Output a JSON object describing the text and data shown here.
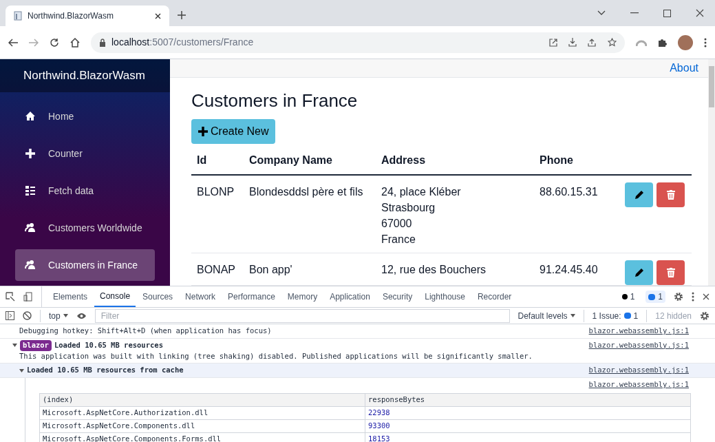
{
  "browser": {
    "tab_title": "Northwind.BlazorWasm",
    "url_host": "localhost",
    "url_path": ":5007/customers/France"
  },
  "app": {
    "brand": "Northwind.BlazorWasm",
    "about_link": "About",
    "nav": [
      {
        "label": "Home",
        "selected": false
      },
      {
        "label": "Counter",
        "selected": false
      },
      {
        "label": "Fetch data",
        "selected": false
      },
      {
        "label": "Customers Worldwide",
        "selected": false
      },
      {
        "label": "Customers in France",
        "selected": true
      }
    ],
    "heading": "Customers in France",
    "create_button": "Create New",
    "table": {
      "columns": [
        "Id",
        "Company Name",
        "Address",
        "Phone"
      ],
      "rows": [
        {
          "id": "BLONP",
          "company": "Blondesddsl père et fils",
          "address": [
            "24, place Kléber",
            "Strasbourg",
            "67000",
            "France"
          ],
          "phone": "88.60.15.31"
        },
        {
          "id": "BONAP",
          "company": "Bon app'",
          "address": [
            "12, rue des Bouchers"
          ],
          "phone": "91.24.45.40"
        }
      ]
    }
  },
  "devtools": {
    "tabs": [
      {
        "label": "Elements",
        "selected": false
      },
      {
        "label": "Console",
        "selected": true
      },
      {
        "label": "Sources",
        "selected": false
      },
      {
        "label": "Network",
        "selected": false
      },
      {
        "label": "Performance",
        "selected": false
      },
      {
        "label": "Memory",
        "selected": false
      },
      {
        "label": "Application",
        "selected": false
      },
      {
        "label": "Security",
        "selected": false
      },
      {
        "label": "Lighthouse",
        "selected": false
      },
      {
        "label": "Recorder",
        "selected": false
      }
    ],
    "error_count": "1",
    "message_count": "1",
    "context": "top",
    "filter_placeholder": "Filter",
    "levels": "Default levels",
    "issues_label": "1 Issue:",
    "issues_count": "1",
    "hidden": "12 hidden",
    "console": [
      {
        "kind": "plain",
        "text": "Debugging hotkey: Shift+Alt+D (when application has focus)",
        "source": "blazor.webassembly.js:1"
      },
      {
        "kind": "badge",
        "badge": "blazor",
        "text": "Loaded 10.65 MB resources",
        "detail": "This application was built with linking (tree shaking) disabled. Published applications will be significantly smaller.",
        "source": "blazor.webassembly.js:1"
      },
      {
        "kind": "group",
        "text": "Loaded 10.65 MB resources from cache",
        "source": "blazor.webassembly.js:1"
      },
      {
        "kind": "table",
        "source": "blazor.webassembly.js:1",
        "columns": [
          "(index)",
          "responseBytes"
        ],
        "rows": [
          [
            "Microsoft.AspNetCore.Authorization.dll",
            "22938"
          ],
          [
            "Microsoft.AspNetCore.Components.dll",
            "93300"
          ],
          [
            "Microsoft.AspNetCore.Components.Forms.dll",
            "18153"
          ]
        ]
      }
    ]
  }
}
